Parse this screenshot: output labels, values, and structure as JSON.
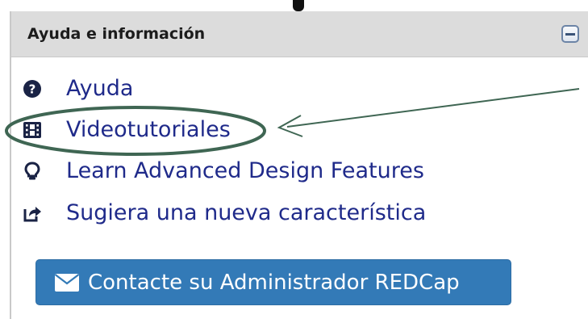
{
  "panel": {
    "title": "Ayuda e información"
  },
  "links": [
    {
      "label": "Ayuda",
      "icon": "question-circle-icon"
    },
    {
      "label": "Videotutoriales",
      "icon": "film-icon"
    },
    {
      "label": "Learn Advanced Design Features",
      "icon": "lightbulb-icon"
    },
    {
      "label": "Sugiera una nueva característica",
      "icon": "share-square-icon"
    }
  ],
  "contact_button": {
    "label": "Contacte su Administrador REDCap",
    "icon": "envelope-icon"
  },
  "colors": {
    "header_bg": "#dcdcdc",
    "link_text": "#1f2a8a",
    "button_bg": "#337ab7",
    "annotation": "#3f6653"
  }
}
